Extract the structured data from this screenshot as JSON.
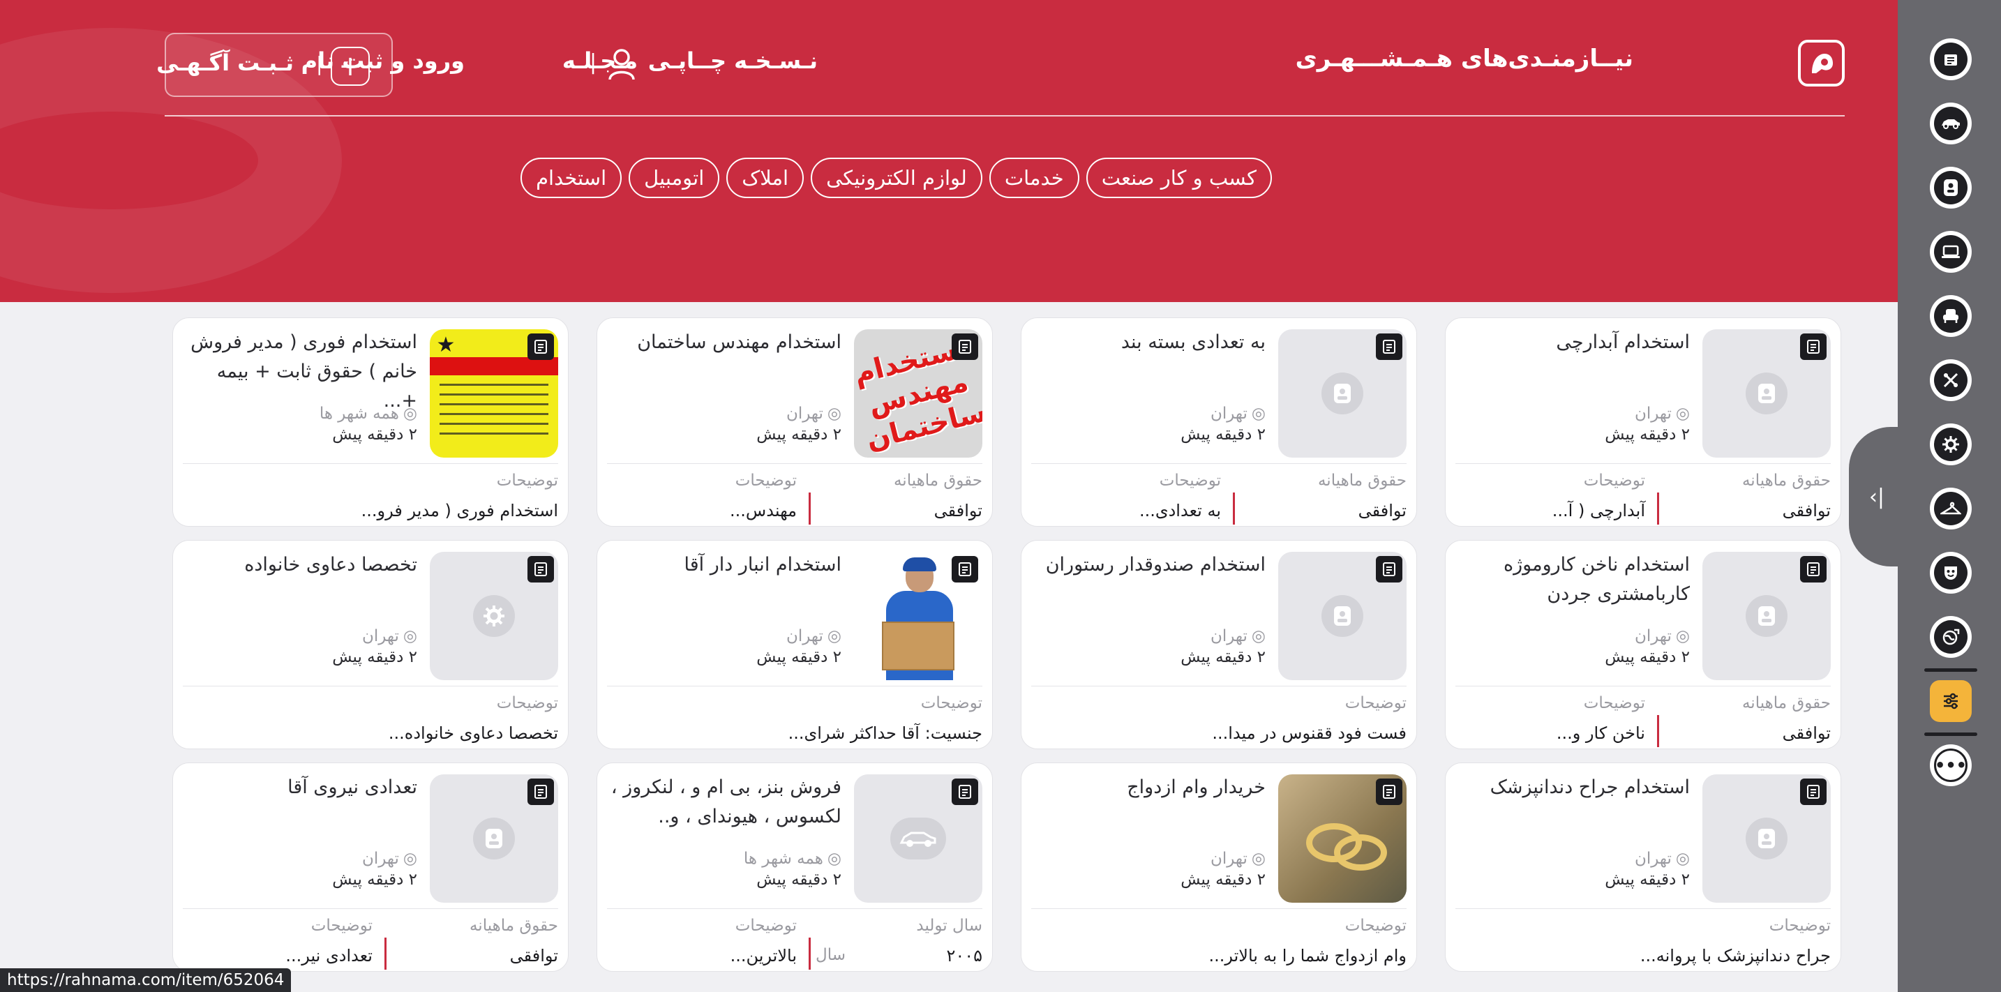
{
  "header": {
    "brand": "نیــازمنـدی‌های هـمـشـــهـری",
    "nav_print": "نـسـخـه چــاپـی",
    "nav_magazine": "مـجـلـه",
    "nav_login": "ورود و ثبت نام",
    "post_ad": "ثـبـت آگـهـی",
    "separator": "|"
  },
  "categories": [
    "استخدام",
    "اتومبیل",
    "املاک",
    "لوازم الکترونیکی",
    "خدمات",
    "کسب و کار صنعت"
  ],
  "cards": [
    {
      "title": "استخدام آبدارچی",
      "location": "تهران",
      "time": "۲ دقیقه پیش",
      "f1_label": "حقوق ماهیانه",
      "f1_value": "توافقی",
      "f2_label": "توضیحات",
      "f2_value": "آبدارچی ( آ..."
    },
    {
      "title": "به تعدادی بسته بند",
      "location": "تهران",
      "time": "۲ دقیقه پیش",
      "f1_label": "حقوق ماهیانه",
      "f1_value": "توافقی",
      "f2_label": "توضیحات",
      "f2_value": "به تعدادی..."
    },
    {
      "title": "استخدام مهندس ساختمان",
      "location": "تهران",
      "time": "۲ دقیقه پیش",
      "f1_label": "حقوق ماهیانه",
      "f1_value": "توافقی",
      "f2_label": "توضیحات",
      "f2_value": "مهندس...",
      "photo_text": "استخدام مهندس ساختمان"
    },
    {
      "title": "استخدام فوری ( مدیر فروش خانم ) حقوق ثابت + بیمه +...",
      "location": "همه شهر ها",
      "time": "۲ دقیقه پیش",
      "f1_label": "توضیحات",
      "f1_value": "استخدام فوری ( مدیر فرو..."
    },
    {
      "title": "استخدام ناخن کاروموژه کاربامشتری جردن",
      "location": "تهران",
      "time": "۲ دقیقه پیش",
      "f1_label": "حقوق ماهیانه",
      "f1_value": "توافقی",
      "f2_label": "توضیحات",
      "f2_value": "ناخن کار و..."
    },
    {
      "title": "استخدام صندوقدار رستوران",
      "location": "تهران",
      "time": "۲ دقیقه پیش",
      "f1_label": "توضیحات",
      "f1_value": "فست فود ققنوس در میدا..."
    },
    {
      "title": "استخدام انبار دار آقا",
      "location": "تهران",
      "time": "۲ دقیقه پیش",
      "f1_label": "توضیحات",
      "f1_value": "جنسیت: آقا حداکثر شرای..."
    },
    {
      "title": "تخصصا دعاوی خانواده",
      "location": "تهران",
      "time": "۲ دقیقه پیش",
      "f1_label": "توضیحات",
      "f1_value": "تخصصا دعاوی خانواده..."
    },
    {
      "title": "استخدام جراح دندانپزشک",
      "location": "تهران",
      "time": "۲ دقیقه پیش",
      "f1_label": "توضیحات",
      "f1_value": "جراح دندانپزشک با پروانه..."
    },
    {
      "title": "خریدار وام ازدواج",
      "location": "تهران",
      "time": "۲ دقیقه پیش",
      "f1_label": "توضیحات",
      "f1_value": "وام ازدواج شما را به بالاتر..."
    },
    {
      "title": "فروش بنز، بی ام و ، لنکروز ، لکسوس ، هیوندای ، و..",
      "location": "همه شهر ها",
      "time": "۲ دقیقه پیش",
      "f1_label": "سال تولید",
      "f1_value": "۲۰۰۵",
      "f1_unit": "سال",
      "f2_label": "توضیحات",
      "f2_value": "بالاترین..."
    },
    {
      "title": "تعدادی نیروی آقا",
      "location": "تهران",
      "time": "۲ دقیقه پیش",
      "f1_label": "حقوق ماهیانه",
      "f1_value": "توافقی",
      "f2_label": "توضیحات",
      "f2_value": "تعدادی نیر..."
    }
  ],
  "status_bar": {
    "url": "https://rahnama.com/item/652064"
  },
  "toolbar": {
    "items": [
      "newspaper-icon",
      "car-icon",
      "contact-icon",
      "laptop-icon",
      "armchair-icon",
      "tools-icon",
      "gear-icon",
      "hanger-icon",
      "mask-icon",
      "globe-icon",
      "sliders-icon",
      "more-icon"
    ],
    "active": "sliders-icon"
  },
  "colors": {
    "brand_red": "#c92c40",
    "accent_yellow": "#f4b43a",
    "toolbar_gray": "#68686d"
  }
}
